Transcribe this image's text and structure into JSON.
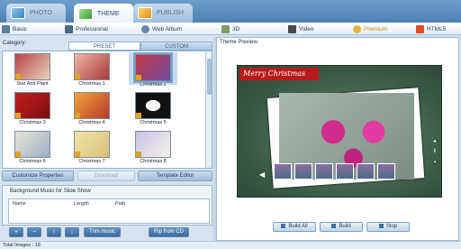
{
  "tabs": [
    {
      "label": "Photo",
      "icon": "photo-icon",
      "active": false
    },
    {
      "label": "Theme",
      "icon": "theme-icon",
      "active": true
    },
    {
      "label": "Publish",
      "icon": "publish-icon",
      "active": false
    }
  ],
  "categories": [
    {
      "label": "Basic",
      "icon": "basic-icon"
    },
    {
      "label": "Professional",
      "icon": "professional-icon"
    },
    {
      "label": "Web Album",
      "icon": "web-album-icon"
    },
    {
      "label": "3D",
      "icon": "3d-icon"
    },
    {
      "label": "Video",
      "icon": "video-icon"
    },
    {
      "label": "Premium",
      "icon": "premium-icon",
      "active": true
    },
    {
      "label": "HTML5",
      "icon": "html5-icon"
    }
  ],
  "left": {
    "category_label": "Category:",
    "subtabs": {
      "preset": "Preset",
      "custom": "Custom"
    },
    "templates": [
      {
        "name": "Star And Plant",
        "color": "#b8444a"
      },
      {
        "name": "Christmas 1",
        "color": "#f1b5a0"
      },
      {
        "name": "Christmas 2",
        "color": "#c63447",
        "selected": true
      },
      {
        "name": "Christmas 3",
        "color": "#c41d1d"
      },
      {
        "name": "Christmas 4",
        "color": "#f2a23a"
      },
      {
        "name": "Christmas 5",
        "color": "#111111"
      },
      {
        "name": "Christmas 6",
        "color": "#e8e3d8"
      },
      {
        "name": "Christmas 7",
        "color": "#f1e4a4"
      },
      {
        "name": "Christmas 8",
        "color": "#c8c1e6"
      }
    ],
    "buttons": {
      "customize": "Customize Properties",
      "download": "Download",
      "template_editor": "Template Editor"
    },
    "music": {
      "title": "Background Music for Slide Show",
      "columns": [
        "Name",
        "Length",
        "Path"
      ]
    },
    "tools": {
      "add": "+",
      "remove": "−",
      "up": "↑",
      "down": "↓",
      "trim": "Trim music",
      "rip": "Rip from CD"
    }
  },
  "preview": {
    "label": "Theme Preview:",
    "banner_text": "Merry Christmas",
    "buttons": {
      "build_all": "Build All",
      "build": "Build",
      "stop": "Stop"
    }
  },
  "status": {
    "total_images": "Total Images : 18"
  }
}
